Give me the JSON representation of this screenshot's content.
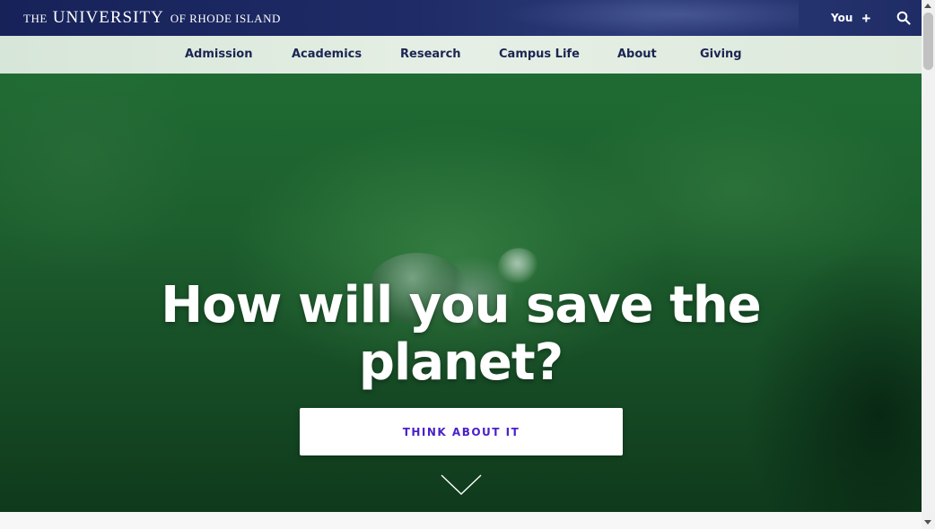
{
  "header": {
    "logo": {
      "the": "The",
      "university": "University",
      "of_rhode_island": "of Rhode Island"
    },
    "you_label": "You",
    "plus_icon": "plus-icon",
    "search_icon": "search-icon",
    "background_color": "#1e2b66"
  },
  "nav": {
    "items": [
      {
        "label": "Admission"
      },
      {
        "label": "Academics"
      },
      {
        "label": "Research"
      },
      {
        "label": "Campus Life"
      },
      {
        "label": "About"
      },
      {
        "label": "Giving"
      }
    ],
    "text_color": "#1b2552",
    "background_color": "#e0ebdf"
  },
  "hero": {
    "title_line1": "How will you save the",
    "title_line2": "planet?",
    "cta_label": "THINK ABOUT IT",
    "cta_text_color": "#4a21c8",
    "scroll_icon": "chevron-down-icon",
    "background": "green leaf with water droplet photo"
  }
}
